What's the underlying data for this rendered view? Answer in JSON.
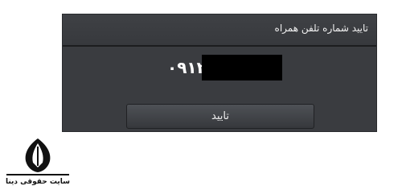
{
  "dialog": {
    "title": "تایید شماره تلفن همراه",
    "phone_prefix": "۰۹۱۲",
    "confirm_label": "تایید"
  },
  "watermark": {
    "site_name": "سایت حقوقی دینا"
  },
  "colors": {
    "dialog_bg": "#3a3c40",
    "text": "#f2f2f2",
    "mask": "#000000"
  }
}
